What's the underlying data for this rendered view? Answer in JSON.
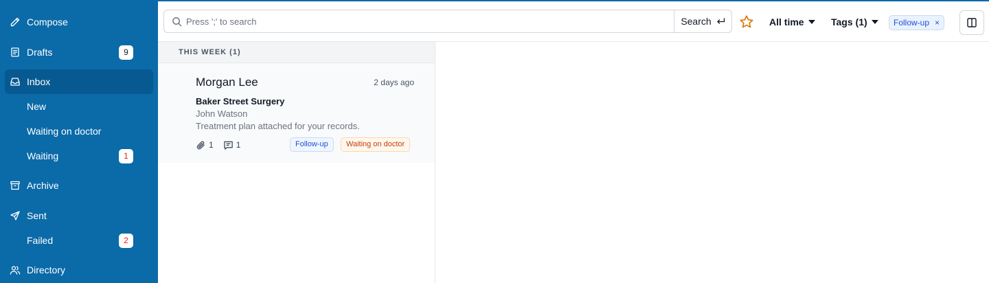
{
  "sidebar": {
    "items": [
      {
        "label": "Compose",
        "icon": "pencil-icon"
      },
      {
        "label": "Drafts",
        "icon": "drafts-icon",
        "badge": "9"
      },
      {
        "label": "Inbox",
        "icon": "inbox-icon",
        "active": true
      },
      {
        "label": "New"
      },
      {
        "label": "Waiting on doctor"
      },
      {
        "label": "Waiting",
        "badge": "1"
      },
      {
        "label": "Archive",
        "icon": "archive-icon"
      },
      {
        "label": "Sent",
        "icon": "send-icon"
      },
      {
        "label": "Failed",
        "badge": "2"
      },
      {
        "label": "Directory",
        "icon": "users-icon"
      }
    ]
  },
  "search": {
    "placeholder": "Press ';' to search",
    "value": "",
    "button_label": "Search"
  },
  "filters": {
    "time_label": "All time",
    "tags_label": "Tags (1)",
    "active_chip": "Follow-up",
    "chip_remove": "×"
  },
  "list": {
    "section_title": "THIS WEEK (1)",
    "messages": [
      {
        "sender": "Morgan Lee",
        "time": "2 days ago",
        "subject": "Baker Street Surgery",
        "doctor": "John Watson",
        "preview": "Treatment plan attached for your records.",
        "attachments": "1",
        "comments": "1",
        "tags": [
          "Follow-up",
          "Waiting on doctor"
        ]
      }
    ]
  },
  "colors": {
    "sidebar_bg": "#0b6aa8",
    "sidebar_active": "#075a91",
    "star": "#d97706",
    "tag_blue": "#1d4ed8",
    "tag_orange": "#c2410c",
    "badge_red": "#dc2626"
  }
}
